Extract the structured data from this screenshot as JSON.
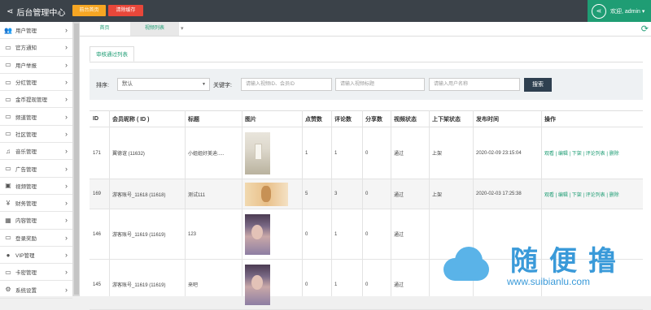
{
  "header": {
    "title": "后台管理中心",
    "btn_home": "前台首页",
    "btn_cache": "清除缓存",
    "user": "欢迎, admin ▾"
  },
  "sidebar": {
    "items": [
      {
        "label": "用户管理",
        "icon": "users-icon",
        "glyph": "👥"
      },
      {
        "label": "官方通知",
        "icon": "monitor-icon",
        "glyph": "▭"
      },
      {
        "label": "用户举报",
        "icon": "monitor-icon",
        "glyph": "▭"
      },
      {
        "label": "分红管理",
        "icon": "monitor-icon",
        "glyph": "▭"
      },
      {
        "label": "金币提现管理",
        "icon": "monitor-icon",
        "glyph": "▭"
      },
      {
        "label": "频道管理",
        "icon": "monitor-icon",
        "glyph": "▭"
      },
      {
        "label": "社区管理",
        "icon": "monitor-icon",
        "glyph": "▭"
      },
      {
        "label": "音乐管理",
        "icon": "music-icon",
        "glyph": "♫"
      },
      {
        "label": "广告管理",
        "icon": "monitor-icon",
        "glyph": "▭"
      },
      {
        "label": "视频管理",
        "icon": "video-icon",
        "glyph": "▣"
      },
      {
        "label": "财务管理",
        "icon": "yen-icon",
        "glyph": "¥"
      },
      {
        "label": "内容管理",
        "icon": "grid-icon",
        "glyph": "▦"
      },
      {
        "label": "登录奖励",
        "icon": "monitor-icon",
        "glyph": "▭"
      },
      {
        "label": "VIP管理",
        "icon": "user-icon",
        "glyph": "●"
      },
      {
        "label": "卡密管理",
        "icon": "monitor-icon",
        "glyph": "▭"
      },
      {
        "label": "系统设置",
        "icon": "gears-icon",
        "glyph": "⚙"
      }
    ]
  },
  "tabs": {
    "t1": "首页",
    "t2": "视频列表"
  },
  "content": {
    "subtab": "审核通过列表",
    "filter": {
      "sort_label": "排序:",
      "sort_value": "默认",
      "keyword_label": "关键字:",
      "ph1": "请输入视频ID、会员ID",
      "ph2": "请输入视频标题",
      "ph3": "请输入用户名称",
      "search": "搜索"
    },
    "columns": [
      "ID",
      "会员昵称 ( ID )",
      "标题",
      "图片",
      "点赞数",
      "评论数",
      "分享数",
      "视频状态",
      "上下架状态",
      "发布时间",
      "操作"
    ],
    "rows": [
      {
        "id": "171",
        "nick": "翼德谊 (11632)",
        "title": "小姐姐好美迪.....",
        "likes": "1",
        "comments": "1",
        "shares": "0",
        "vstat": "通过",
        "shelf": "上架",
        "time": "2020-02-09 23:15:04",
        "ops": "观看 | 编辑 | 下架 | 评论列表 | 删除"
      },
      {
        "id": "169",
        "nick": "游客账号_11618 (11618)",
        "title": "测试111",
        "likes": "5",
        "comments": "3",
        "shares": "0",
        "vstat": "通过",
        "shelf": "上架",
        "time": "2020-02-03 17:25:38",
        "ops": "观看 | 编辑 | 下架 | 评论列表 | 删除"
      },
      {
        "id": "146",
        "nick": "游客账号_11619 (11619)",
        "title": "123",
        "likes": "0",
        "comments": "1",
        "shares": "0",
        "vstat": "通过",
        "shelf": "",
        "time": "",
        "ops": ""
      },
      {
        "id": "145",
        "nick": "游客账号_11619 (11619)",
        "title": "来吧",
        "likes": "0",
        "comments": "1",
        "shares": "0",
        "vstat": "通过",
        "shelf": "",
        "time": "",
        "ops": ""
      }
    ]
  },
  "watermark": {
    "cn": "随便撸",
    "url": "www.suibianlu.com"
  },
  "colors": {
    "header": "#3b4249",
    "accent": "#1f9d74",
    "btn_home": "#f6a623",
    "btn_cache": "#e8473a",
    "search": "#2f4050"
  }
}
